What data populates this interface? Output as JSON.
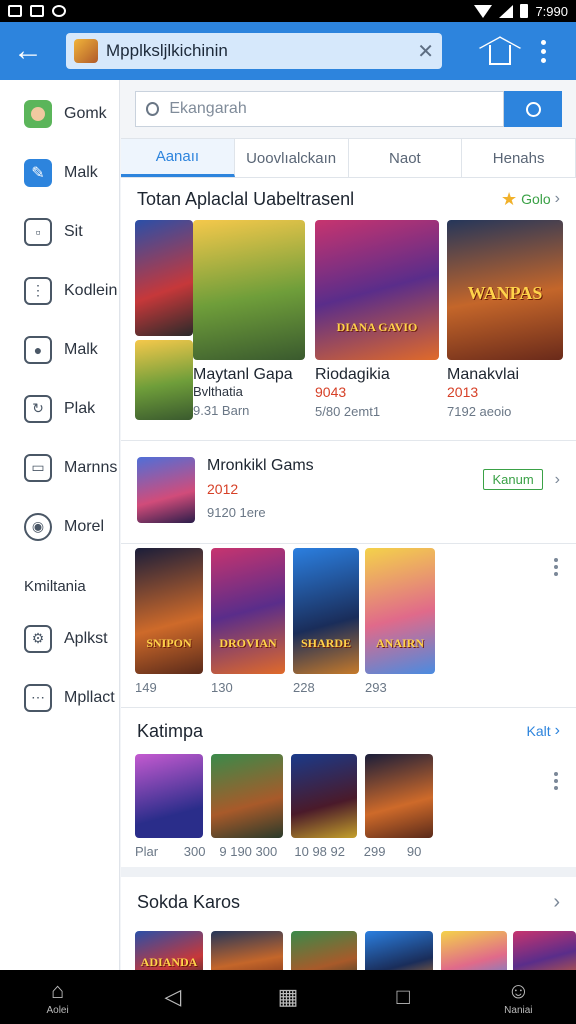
{
  "status": {
    "time": "7:990"
  },
  "appbar": {
    "url_text": "Mpplksljlkichinin"
  },
  "sidebar": {
    "items": [
      {
        "label": "Gomk",
        "icon": "avatar-icon"
      },
      {
        "label": "Malk",
        "icon": "pencil-icon"
      },
      {
        "label": "Sit",
        "icon": "window-icon"
      },
      {
        "label": "Kodlein",
        "icon": "clipboard-icon"
      },
      {
        "label": "Malk",
        "icon": "shield-icon"
      },
      {
        "label": "Plak",
        "icon": "refresh-icon"
      },
      {
        "label": "Marnns",
        "icon": "copy-icon"
      },
      {
        "label": "Morel",
        "icon": "settings-icon"
      }
    ],
    "section_heading": "Kmiltania",
    "section_items": [
      {
        "label": "Aplkst",
        "icon": "tools-icon"
      },
      {
        "label": "Mpllact",
        "icon": "face-icon"
      }
    ]
  },
  "search": {
    "placeholder": "Ekangarah"
  },
  "tabs": [
    "Aanaıı",
    "Uoovlıalckaın",
    "Naot",
    "Henahs"
  ],
  "featured": {
    "title": "Totan Aplaclal Uabeltrasenl",
    "link": "Golo",
    "items": [
      {
        "title": "Maytanl Gapa",
        "sub": "Bvlthatia",
        "meta": "9.31 Barn"
      },
      {
        "title": "Riodagikia",
        "sub": "9043",
        "meta": "5/80 2emt1"
      },
      {
        "title": "Manakvlai",
        "sub": "2013",
        "meta": "7192 aeoio"
      }
    ],
    "tile_captions": [
      "",
      "",
      "DIANA GAVIO",
      "WANPAS"
    ]
  },
  "single": {
    "title": "Mronkikl Gams",
    "year": "2012",
    "meta": "9120 1ere",
    "button": "Kanum"
  },
  "thumbs1": {
    "captions": [
      "SNIPON",
      "DROVIAN",
      "SHARDE",
      "ANAIRN"
    ],
    "labels": [
      "149",
      "130",
      "228",
      "293"
    ]
  },
  "category": {
    "title": "Katimpa",
    "link": "Kalt",
    "labels": [
      "Plar",
      "300",
      "9 190 300",
      "10 98 92",
      "299",
      "90"
    ]
  },
  "bottom_section": {
    "title": "Sokda Karos",
    "captions": [
      "ADIANDA",
      "",
      "",
      "",
      "",
      ""
    ]
  },
  "navbar": {
    "home_label": "Aolei",
    "account_label": "Naniai"
  }
}
